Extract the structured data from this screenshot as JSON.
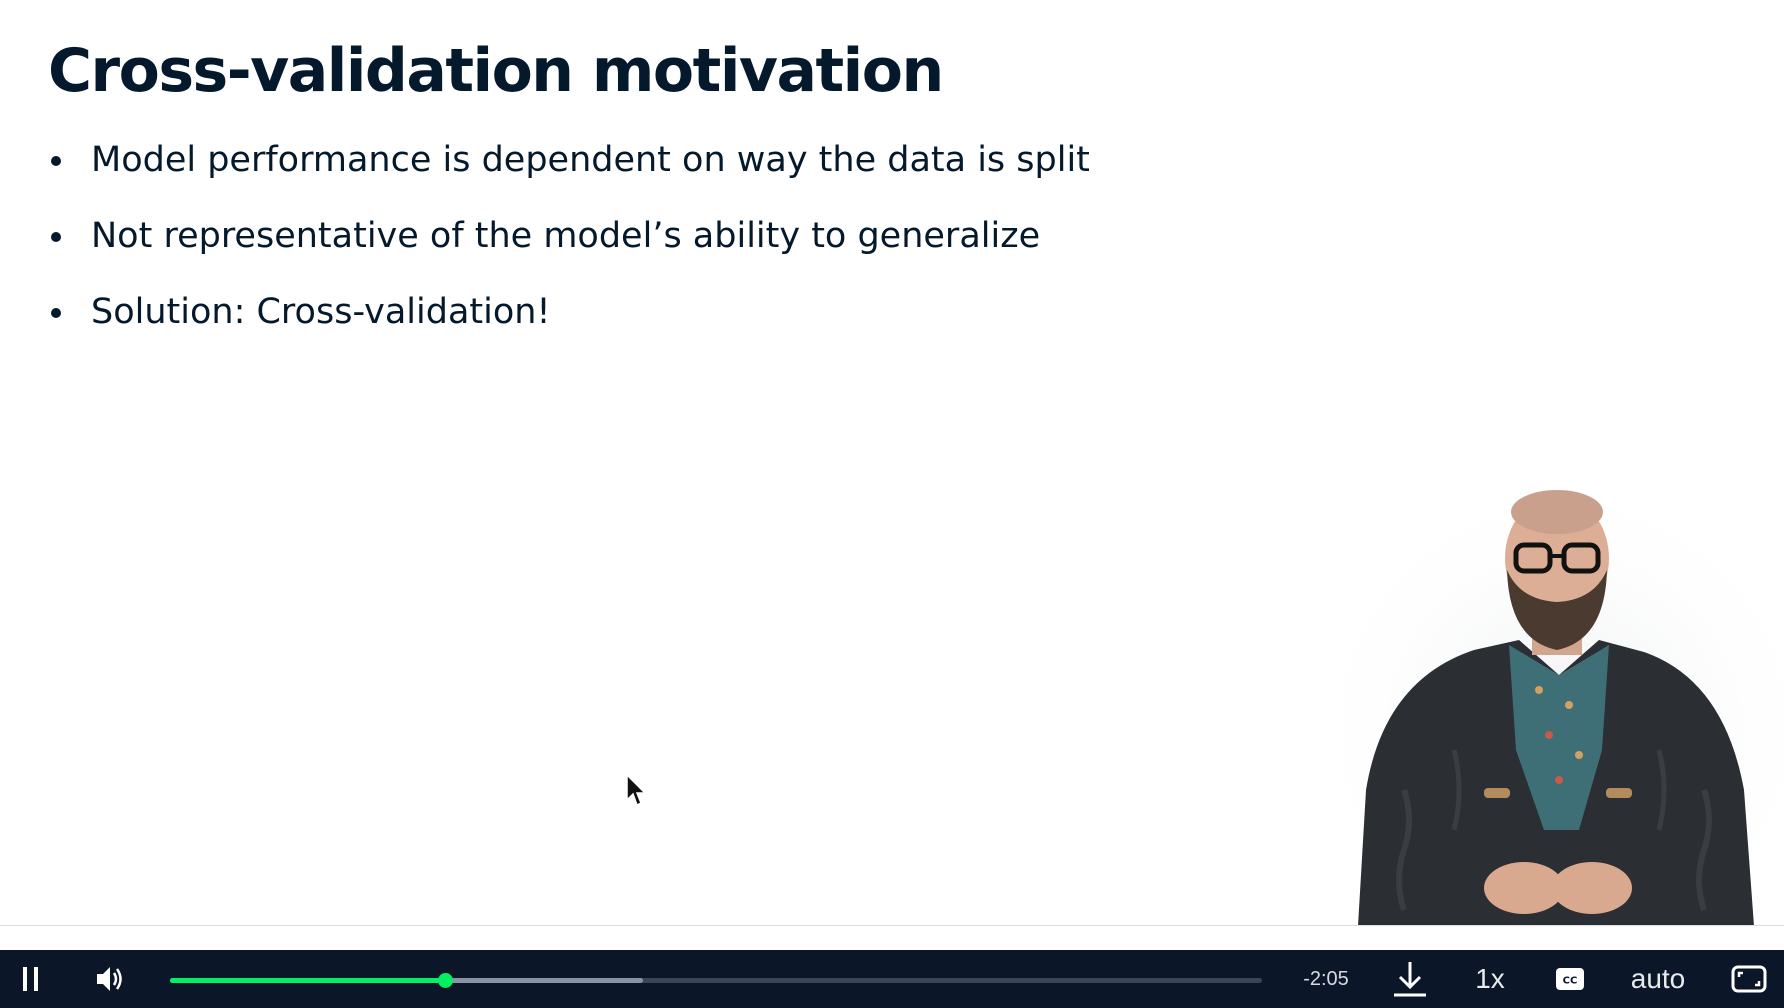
{
  "slide": {
    "title": "Cross-validation motivation",
    "bullets": [
      "Model performance is dependent on way the data is split",
      "Not representative of the model’s ability to generalize",
      "Solution: Cross-validation!"
    ]
  },
  "player": {
    "play_state_icon": "pause-icon",
    "volume_icon": "volume-icon",
    "played_fraction": 0.252,
    "buffered_fraction": 0.433,
    "time_remaining": "-2:05",
    "download_icon": "download-icon",
    "speed": "1x",
    "captions_icon": "closed-captions-icon",
    "quality": "auto",
    "fullscreen_icon": "fullscreen-icon"
  },
  "colors": {
    "accent": "#03ef62",
    "player_bg": "#0b1629",
    "title_text": "#05192d"
  }
}
